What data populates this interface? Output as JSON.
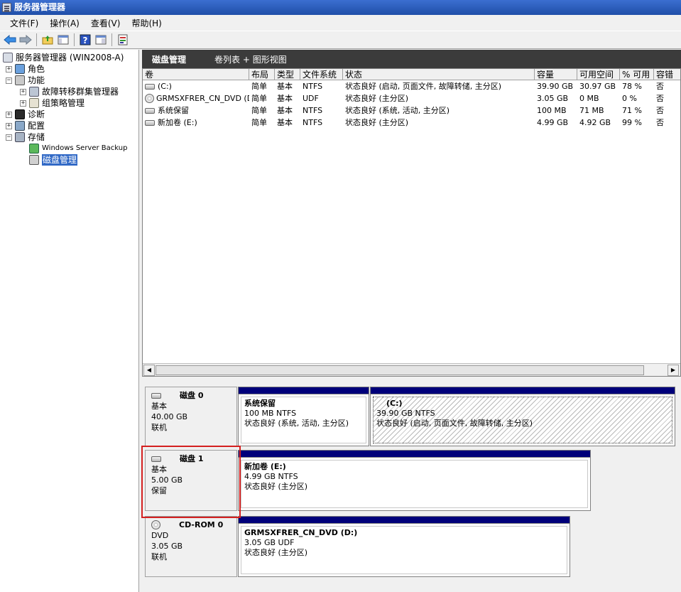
{
  "window": {
    "title": "服务器管理器"
  },
  "menu": [
    "文件(F)",
    "操作(A)",
    "查看(V)",
    "帮助(H)"
  ],
  "toolbar": {
    "icons": [
      "back-arrow-icon",
      "forward-arrow-icon",
      "up-folder-icon",
      "show-hide-tree-icon",
      "help-icon",
      "properties-icon",
      "export-icon"
    ]
  },
  "tree": {
    "root": "服务器管理器 (WIN2008-A)",
    "roles": "角色",
    "features": "功能",
    "failover": "故障转移群集管理器",
    "gpm": "组策略管理",
    "diagnostics": "诊断",
    "configuration": "配置",
    "storage": "存储",
    "wsb": "Windows Server Backup",
    "diskmgmt": "磁盘管理"
  },
  "main": {
    "title": "磁盘管理",
    "views": "卷列表 + 图形视图"
  },
  "table": {
    "headers": [
      "卷",
      "布局",
      "类型",
      "文件系统",
      "状态",
      "容量",
      "可用空间",
      "% 可用",
      "容错"
    ],
    "rows": [
      {
        "vol": " (C:)",
        "layout": "简单",
        "type": "基本",
        "fs": "NTFS",
        "status": "状态良好 (启动, 页面文件, 故障转储, 主分区)",
        "cap": "39.90 GB",
        "free": "30.97 GB",
        "pct": "78 %",
        "ft": "否",
        "icon": "drive"
      },
      {
        "vol": "GRMSXFRER_CN_DVD (D:)",
        "layout": "简单",
        "type": "基本",
        "fs": "UDF",
        "status": "状态良好 (主分区)",
        "cap": "3.05 GB",
        "free": "0 MB",
        "pct": "0 %",
        "ft": "否",
        "icon": "cd"
      },
      {
        "vol": "系统保留",
        "layout": "简单",
        "type": "基本",
        "fs": "NTFS",
        "status": "状态良好 (系统, 活动, 主分区)",
        "cap": "100 MB",
        "free": "71 MB",
        "pct": "71 %",
        "ft": "否",
        "icon": "drive"
      },
      {
        "vol": "新加卷 (E:)",
        "layout": "简单",
        "type": "基本",
        "fs": "NTFS",
        "status": "状态良好 (主分区)",
        "cap": "4.99 GB",
        "free": "4.92 GB",
        "pct": "99 %",
        "ft": "否",
        "icon": "drive"
      }
    ]
  },
  "disks": {
    "disk0": {
      "name": "磁盘 0",
      "type": "基本",
      "size": "40.00 GB",
      "state": "联机",
      "p1": {
        "name": "系统保留",
        "size": "100 MB NTFS",
        "status": "状态良好 (系统, 活动, 主分区)"
      },
      "p2": {
        "name": "(C:)",
        "size": "39.90 GB NTFS",
        "status": "状态良好 (启动, 页面文件, 故障转储, 主分区)"
      }
    },
    "disk1": {
      "name": "磁盘 1",
      "type": "基本",
      "size": "5.00 GB",
      "state": "保留",
      "p1": {
        "name": "新加卷  (E:)",
        "size": "4.99 GB NTFS",
        "status": "状态良好 (主分区)"
      }
    },
    "cdrom0": {
      "name": "CD-ROM 0",
      "type": "DVD",
      "size": "3.05 GB",
      "state": "联机",
      "p1": {
        "name": "GRMSXFRER_CN_DVD  (D:)",
        "size": "3.05 GB UDF",
        "status": "状态良好 (主分区)"
      }
    }
  }
}
